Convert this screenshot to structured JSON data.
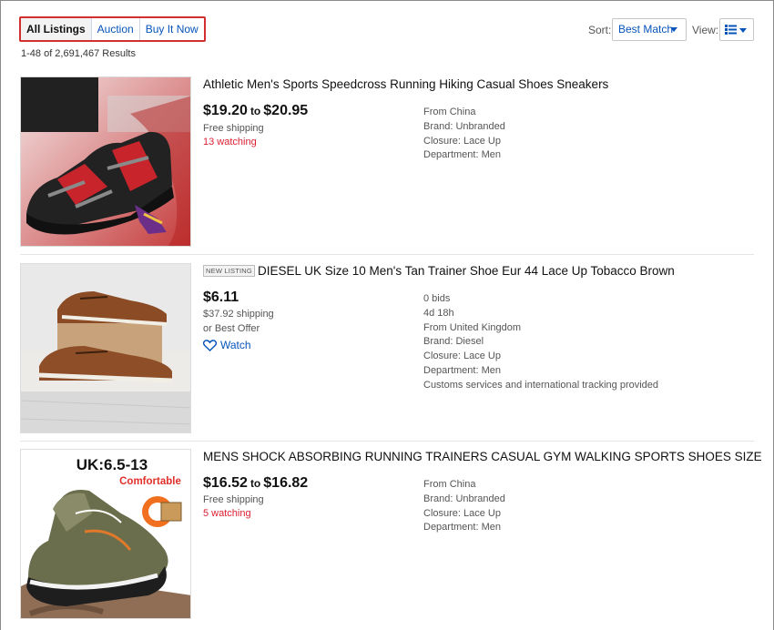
{
  "tabs": [
    {
      "label": "All Listings",
      "active": true
    },
    {
      "label": "Auction",
      "active": false
    },
    {
      "label": "Buy It Now",
      "active": false
    }
  ],
  "results_count": "1-48 of 2,691,467 Results",
  "sort": {
    "label": "Sort:",
    "value": "Best Match"
  },
  "view": {
    "label": "View:",
    "icon": "list-view-icon"
  },
  "items": [
    {
      "title": "Athletic Men's Sports Speedcross Running Hiking Casual Shoes Sneakers",
      "badge": "",
      "price_low": "$19.20",
      "price_to": "to",
      "price_high": "$20.95",
      "shipping": "Free shipping",
      "extra": "13 watching",
      "attributes": [
        "From China",
        "Brand: Unbranded",
        "Closure: Lace Up",
        "Department: Men"
      ]
    },
    {
      "title": "DIESEL UK Size 10 Men's Tan Trainer Shoe Eur 44 Lace Up Tobacco Brown",
      "badge": "NEW LISTING",
      "price": "$6.11",
      "shipping": "$37.92 shipping",
      "offer": "or Best Offer",
      "watch": "Watch",
      "attributes": [
        "0 bids",
        "4d 18h",
        "From United Kingdom",
        "Brand: Diesel",
        "Closure: Lace Up",
        "Department: Men",
        "Customs services and international tracking provided"
      ]
    },
    {
      "title": "MENS SHOCK ABSORBING RUNNING TRAINERS CASUAL GYM WALKING SPORTS SHOES SIZE",
      "badge": "",
      "price_low": "$16.52",
      "price_to": "to",
      "price_high": "$16.82",
      "shipping": "Free shipping",
      "extra": "5 watching",
      "attributes": [
        "From China",
        "Brand: Unbranded",
        "Closure: Lace Up",
        "Department: Men"
      ],
      "image_text": {
        "size": "UK:6.5-13",
        "tag": "Comfortable"
      }
    }
  ],
  "colors": {
    "link": "#0654ba",
    "watching": "#dd1e31",
    "highlight": "#d32f2f"
  }
}
